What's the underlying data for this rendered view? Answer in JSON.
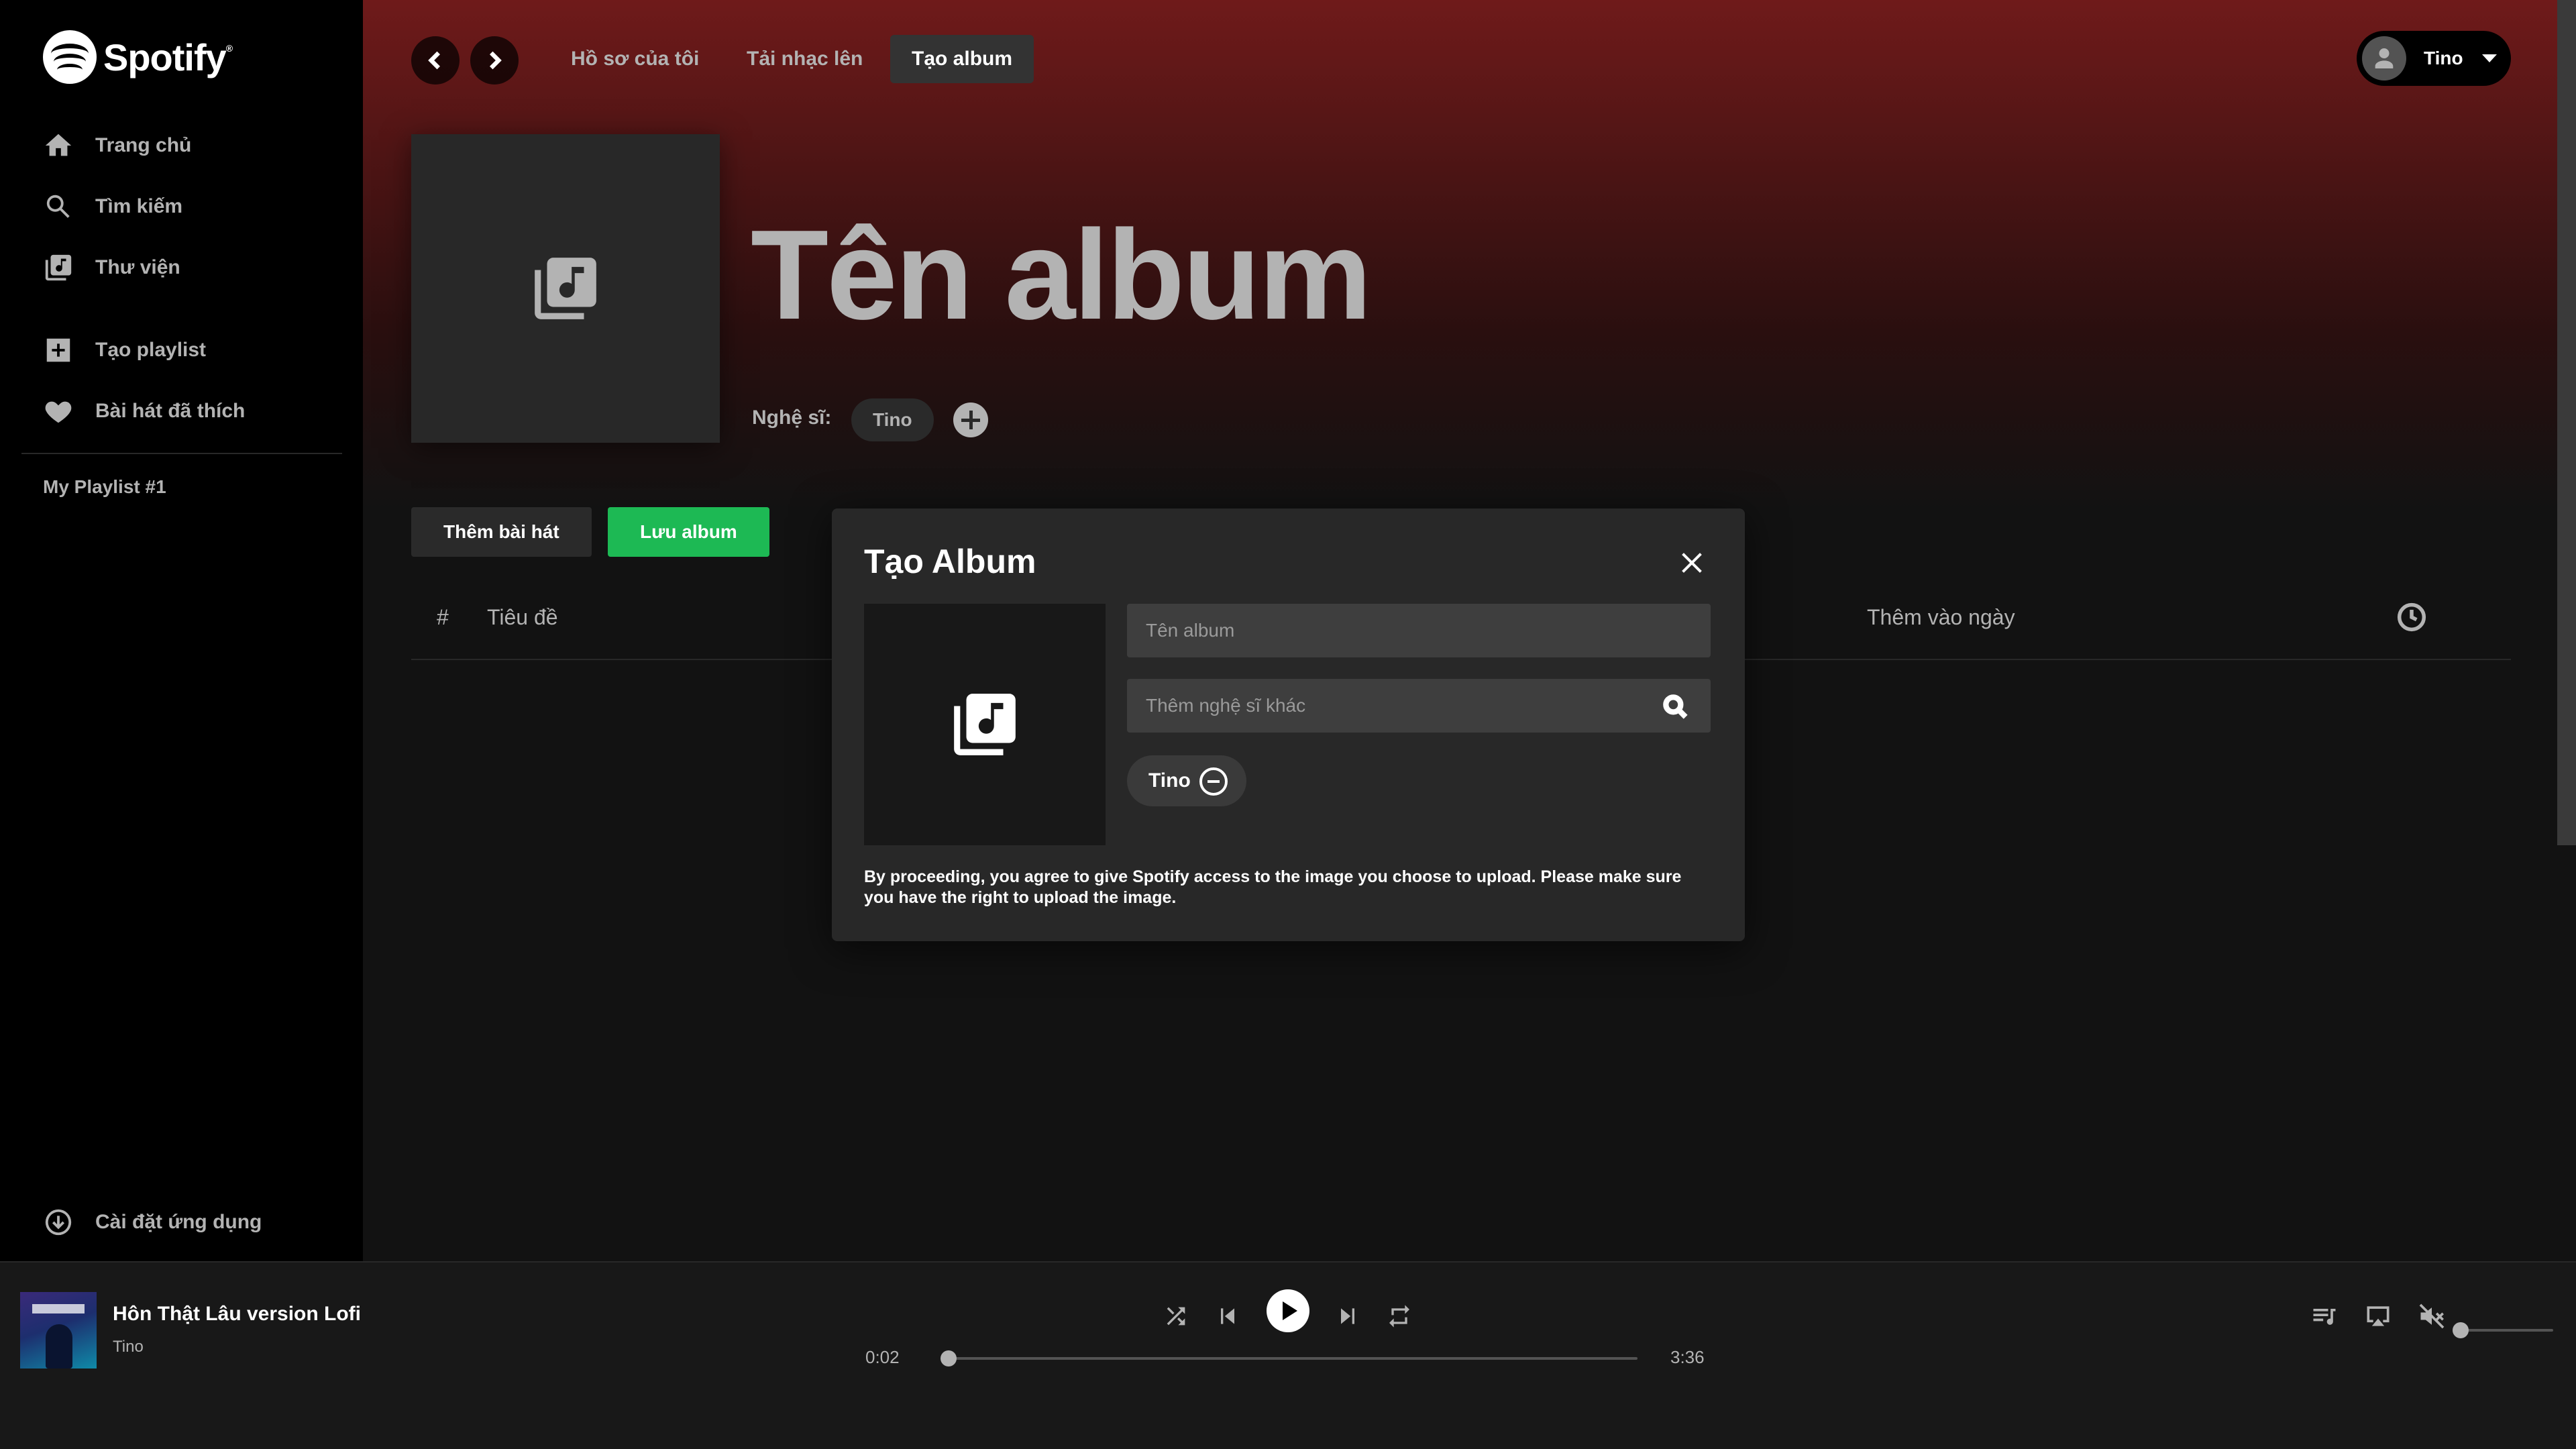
{
  "app": {
    "brand": "Spotify",
    "accent_color": "#1db954"
  },
  "sidebar": {
    "nav": [
      {
        "label": "Trang chủ",
        "icon": "home-icon"
      },
      {
        "label": "Tìm kiếm",
        "icon": "search-icon"
      },
      {
        "label": "Thư viện",
        "icon": "library-icon"
      }
    ],
    "actions": [
      {
        "label": "Tạo playlist",
        "icon": "plus-square-icon"
      },
      {
        "label": "Bài hát đã thích",
        "icon": "heart-icon"
      }
    ],
    "playlists": [
      "My Playlist #1"
    ],
    "install_label": "Cài đặt ứng dụng"
  },
  "topbar": {
    "tabs": [
      "Hồ sơ của tôi",
      "Tải nhạc lên",
      "Tạo album"
    ],
    "active_tab": "Tạo album",
    "user_name": "Tino"
  },
  "album": {
    "title": "Tên album",
    "artist_label": "Nghệ sĩ:",
    "artist": "Tino",
    "add_song_label": "Thêm bài hát",
    "save_label": "Lưu album"
  },
  "table": {
    "columns": [
      "#",
      "Tiêu đề",
      "Thêm vào ngày"
    ],
    "duration_icon": "clock-icon"
  },
  "modal": {
    "title": "Tạo Album",
    "album_name_placeholder": "Tên album",
    "artist_search_placeholder": "Thêm nghệ sĩ khác",
    "selected_artist": "Tino",
    "disclaimer": "By proceeding, you agree to give Spotify access to the image you choose to upload. Please make sure you have the right to upload the image."
  },
  "player": {
    "track_title": "Hôn Thật Lâu version Lofi",
    "track_artist": "Tino",
    "elapsed": "0:02",
    "duration": "3:36",
    "progress": 0.009,
    "volume": 0.0,
    "muted": true
  }
}
